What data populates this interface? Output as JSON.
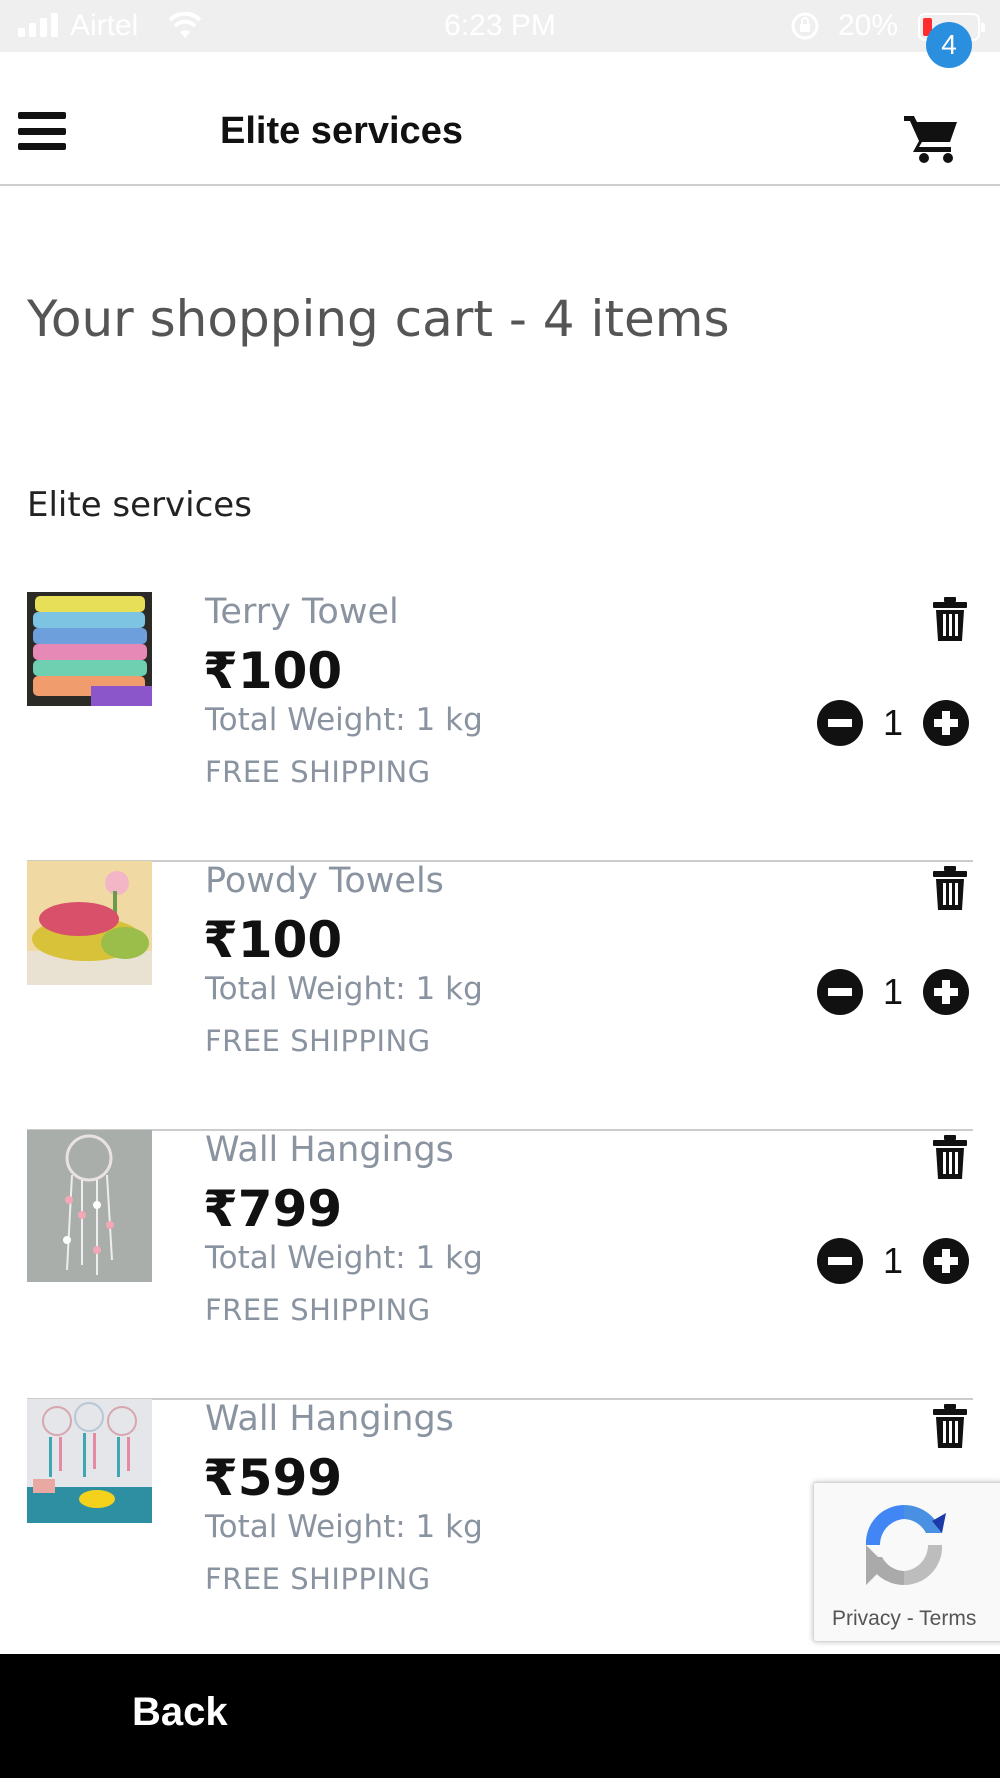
{
  "status_bar": {
    "carrier": "Airtel",
    "time": "6:23 PM",
    "battery_percent": "20%",
    "battery_color": "#ff2d2d"
  },
  "header": {
    "title": "Elite services",
    "menu_icon": "hamburger-icon",
    "cart_icon": "shopping-cart-icon",
    "cart_badge": "4",
    "badge_color": "#2b8fe0"
  },
  "main": {
    "heading": "Your shopping cart - 4 items",
    "store_name": "Elite services"
  },
  "cart": {
    "items": [
      {
        "name": "Terry Towel",
        "price": "₹100",
        "weight": "Total Weight: 1 kg",
        "shipping": "FREE SHIPPING",
        "quantity": "1",
        "image": "stacked-towels"
      },
      {
        "name": "Powdy Towels",
        "price": "₹100",
        "weight": "Total Weight: 1 kg",
        "shipping": "FREE SHIPPING",
        "quantity": "1",
        "image": "rolled-towels"
      },
      {
        "name": "Wall Hangings",
        "price": "₹799",
        "weight": "Total Weight: 1 kg",
        "shipping": "FREE SHIPPING",
        "quantity": "1",
        "image": "dreamcatcher"
      },
      {
        "name": "Wall Hangings",
        "price": "₹599",
        "weight": "Total Weight: 1 kg",
        "shipping": "FREE SHIPPING",
        "image": "dreamcatcher-set"
      }
    ]
  },
  "recaptcha": {
    "privacy": "Privacy",
    "separator": " - ",
    "terms": "Terms"
  },
  "footer": {
    "back_label": "Back"
  }
}
